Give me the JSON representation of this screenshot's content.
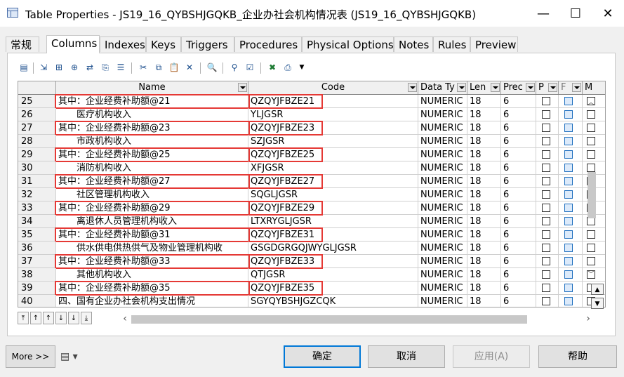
{
  "window": {
    "title": "Table Properties - JS19_16_QYBSHJGQKB_企业办社会机构情况表 (JS19_16_QYBSHJGQKB)",
    "minimize_glyph": "—",
    "maximize_glyph": "☐",
    "close_glyph": "✕"
  },
  "tabs": [
    "常规",
    "Columns",
    "Indexes",
    "Keys",
    "Triggers",
    "Procedures",
    "Physical Options",
    "Notes",
    "Rules",
    "Preview"
  ],
  "active_tab": "Columns",
  "columns_header": {
    "name": "Name",
    "code": "Code",
    "data_type": "Data Ty",
    "length": "Len",
    "precision": "Prec",
    "p": "P",
    "f": "F",
    "m": "M"
  },
  "rows": [
    {
      "num": "25",
      "name": "其中：企业经费补助额@21",
      "code": "QZQYJFBZE21",
      "type": "NUMERIC",
      "len": "18",
      "prec": "6",
      "hl": true
    },
    {
      "num": "26",
      "name": "　　医疗机构收入",
      "code": "YLJGSR",
      "type": "NUMERIC",
      "len": "18",
      "prec": "6",
      "hl": false
    },
    {
      "num": "27",
      "name": "其中：企业经费补助额@23",
      "code": "QZQYJFBZE23",
      "type": "NUMERIC",
      "len": "18",
      "prec": "6",
      "hl": true
    },
    {
      "num": "28",
      "name": "　　市政机构收入",
      "code": "SZJGSR",
      "type": "NUMERIC",
      "len": "18",
      "prec": "6",
      "hl": false
    },
    {
      "num": "29",
      "name": "其中：企业经费补助额@25",
      "code": "QZQYJFBZE25",
      "type": "NUMERIC",
      "len": "18",
      "prec": "6",
      "hl": true
    },
    {
      "num": "30",
      "name": "　　消防机构收入",
      "code": "XFJGSR",
      "type": "NUMERIC",
      "len": "18",
      "prec": "6",
      "hl": false
    },
    {
      "num": "31",
      "name": "其中：企业经费补助额@27",
      "code": "QZQYJFBZE27",
      "type": "NUMERIC",
      "len": "18",
      "prec": "6",
      "hl": true
    },
    {
      "num": "32",
      "name": "　　社区管理机构收入",
      "code": "SQGLJGSR",
      "type": "NUMERIC",
      "len": "18",
      "prec": "6",
      "hl": false
    },
    {
      "num": "33",
      "name": "其中：企业经费补助额@29",
      "code": "QZQYJFBZE29",
      "type": "NUMERIC",
      "len": "18",
      "prec": "6",
      "hl": true
    },
    {
      "num": "34",
      "name": "　　离退休人员管理机构收入",
      "code": "LTXRYGLJGSR",
      "type": "NUMERIC",
      "len": "18",
      "prec": "6",
      "hl": false
    },
    {
      "num": "35",
      "name": "其中：企业经费补助额@31",
      "code": "QZQYJFBZE31",
      "type": "NUMERIC",
      "len": "18",
      "prec": "6",
      "hl": true
    },
    {
      "num": "36",
      "name": "　　供水供电供热供气及物业管理机构收",
      "code": "GSGDGRGQJWYGLJGSR",
      "type": "NUMERIC",
      "len": "18",
      "prec": "6",
      "hl": false
    },
    {
      "num": "37",
      "name": "其中：企业经费补助额@33",
      "code": "QZQYJFBZE33",
      "type": "NUMERIC",
      "len": "18",
      "prec": "6",
      "hl": true
    },
    {
      "num": "38",
      "name": "　　其他机构收入",
      "code": "QTJGSR",
      "type": "NUMERIC",
      "len": "18",
      "prec": "6",
      "hl": false
    },
    {
      "num": "39",
      "name": "其中：企业经费补助额@35",
      "code": "QZQYJFBZE35",
      "type": "NUMERIC",
      "len": "18",
      "prec": "6",
      "hl": true
    },
    {
      "num": "40",
      "name": "四、国有企业办社会机构支出情况",
      "code": "SGYQYBSHJGZCQK",
      "type": "NUMERIC",
      "len": "18",
      "prec": "6",
      "hl": false
    }
  ],
  "toolbar_icons": [
    "properties-icon",
    "insert-row-icon",
    "add-row-icon",
    "add-attributes-icon",
    "replace-attributes-icon",
    "paste-as-new-icon",
    "paste-icon",
    "cut-icon",
    "copy-icon",
    "paste-icon",
    "delete-icon",
    "find-icon",
    "filter-icon",
    "customize-columns-icon",
    "excel-export-icon",
    "print-icon",
    "dropdown-arrow-icon"
  ],
  "toolbar_glyphs": [
    "▤",
    "⇲",
    "⊞",
    "⊕",
    "⇄",
    "⎘",
    "☰",
    "✂",
    "⧉",
    "📋",
    "✕",
    "🔍",
    "⚲",
    "☑",
    "✖",
    "⎙",
    "▼"
  ],
  "row_buttons": [
    "⤒",
    "↑",
    "↑",
    "↓",
    "↓",
    "⤓"
  ],
  "scroll": {
    "up": "︿",
    "down": "﹀",
    "left": "‹",
    "right": "›",
    "collapse": "▲",
    "expand": "▼"
  },
  "footer": {
    "more": "More >>",
    "confirm": "确定",
    "cancel": "取消",
    "apply": "应用(A)",
    "help": "帮助",
    "menu_icon": "▤ ▾"
  }
}
